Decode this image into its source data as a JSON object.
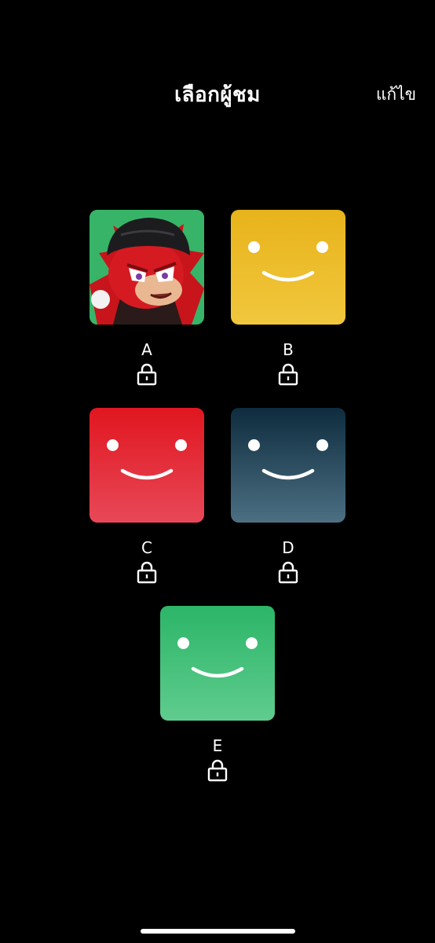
{
  "header": {
    "title": "เลือกผู้ชม",
    "edit_label": "แก้ไข"
  },
  "profiles": [
    {
      "name": "A",
      "avatar": "character-portrait",
      "locked": true
    },
    {
      "name": "B",
      "avatar": "smiley-face",
      "color_top": "#e8b31b",
      "color_bottom": "#f1c73d",
      "locked": true
    },
    {
      "name": "C",
      "avatar": "smiley-face",
      "color_top": "#e0161f",
      "color_bottom": "#e84858",
      "locked": true
    },
    {
      "name": "D",
      "avatar": "smiley-face",
      "color_top": "#0e2c3e",
      "color_bottom": "#4c6f83",
      "locked": true
    },
    {
      "name": "E",
      "avatar": "smiley-face",
      "color_top": "#2cb568",
      "color_bottom": "#5fcc8e",
      "locked": true
    }
  ],
  "icons": {
    "lock": "lock-icon"
  }
}
